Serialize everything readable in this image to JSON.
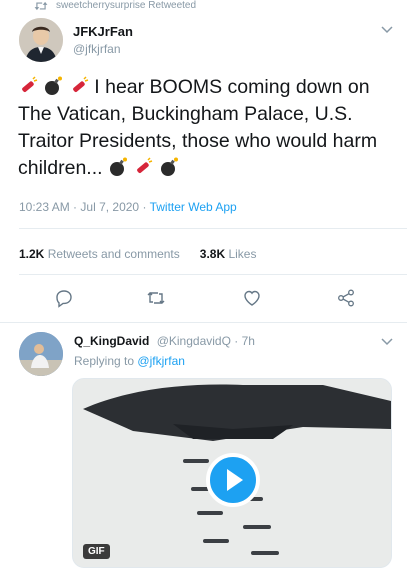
{
  "retweet": {
    "text": "sweetcherrysurprise Retweeted",
    "icon": "retweet-icon"
  },
  "author": {
    "name": "JFKJrFan",
    "handle": "@jfkjrfan"
  },
  "tweet": {
    "text_part1": "I hear BOOMS coming down on The Vatican, Buckingham Palace, U.S. Traitor Presidents, those who would harm children...",
    "emojis": [
      "firecracker-icon",
      "bomb-icon",
      "firecracker-icon",
      "bomb-icon",
      "firecracker-icon",
      "bomb-icon"
    ]
  },
  "meta": {
    "time": "10:23 AM",
    "sep": "·",
    "date": "Jul 7, 2020",
    "source": "Twitter Web App"
  },
  "stats": {
    "retweets_count": "1.2K",
    "retweets_label": "Retweets and comments",
    "likes_count": "3.8K",
    "likes_label": "Likes"
  },
  "actions": [
    "reply-icon",
    "retweet-icon",
    "like-icon",
    "share-icon"
  ],
  "reply": {
    "name": "Q_KingDavid",
    "handle": "@KingdavidQ",
    "sep": "·",
    "time": "7h",
    "replying_prefix": "Replying to",
    "mention": "@jfkjrfan",
    "gif_label": "GIF"
  },
  "colors": {
    "accent": "#1da1f2",
    "muted": "#8899a6",
    "text": "#14171a"
  }
}
